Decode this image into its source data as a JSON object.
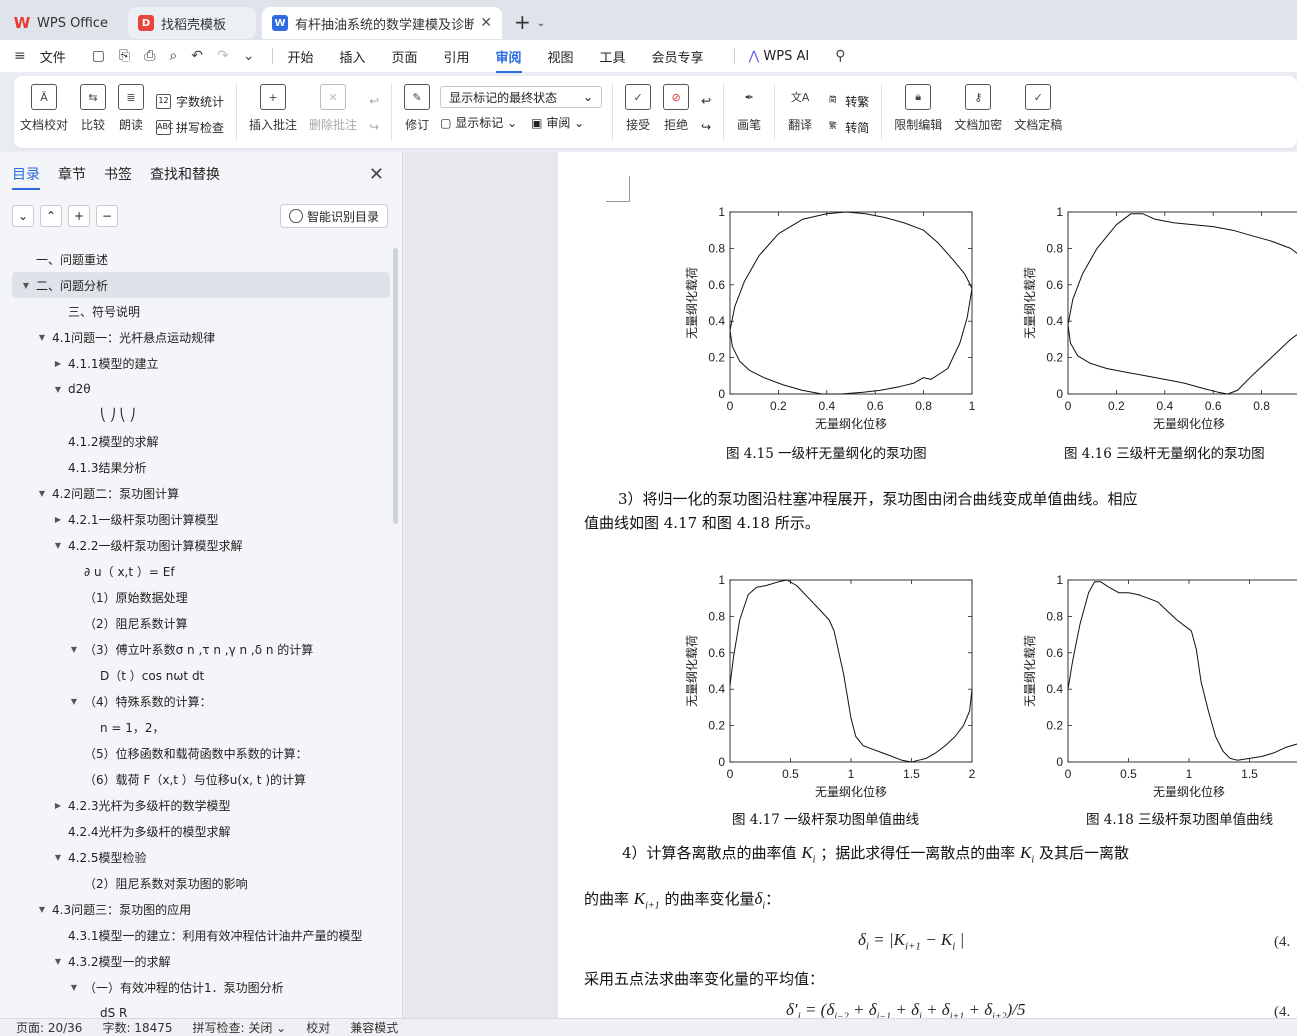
{
  "tabs": {
    "home": "WPS Office",
    "template": "找稻壳模板",
    "document": "有杆抽油系统的数学建模及诊断"
  },
  "menu": {
    "file": "文件",
    "items": [
      "开始",
      "插入",
      "页面",
      "引用",
      "审阅",
      "视图",
      "工具",
      "会员专享"
    ],
    "ai": "WPS AI"
  },
  "ribbon": {
    "proofread": "文档校对",
    "compare": "比较",
    "read_aloud": "朗读",
    "word_count": "字数统计",
    "spell_check": "拼写检查",
    "insert_comment": "插入批注",
    "delete_comment": "删除批注",
    "revise": "修订",
    "markup_select": "显示标记的最终状态",
    "show_markup": "显示标记",
    "review_pane": "审阅",
    "accept": "接受",
    "reject": "拒绝",
    "pen": "画笔",
    "translate": "翻译",
    "to_traditional": "转繁",
    "to_simplified": "转简",
    "restrict_edit": "限制编辑",
    "encrypt": "文档加密",
    "finalize": "文档定稿"
  },
  "sidebar": {
    "tabs": [
      "目录",
      "章节",
      "书签",
      "查找和替换"
    ],
    "smart_toc": "智能识别目录",
    "toc": [
      {
        "label": "一、问题重述",
        "indent": 0,
        "arrow": ""
      },
      {
        "label": "二、问题分析",
        "indent": 0,
        "arrow": "down",
        "selected": true
      },
      {
        "label": "三、符号说明",
        "indent": 2,
        "arrow": ""
      },
      {
        "label": "4.1问题一：光杆悬点运动规律",
        "indent": 1,
        "arrow": "down"
      },
      {
        "label": "4.1.1模型的建立",
        "indent": 2,
        "arrow": "right"
      },
      {
        "label": "d2θ",
        "indent": 2,
        "arrow": "down"
      },
      {
        "label": "⎝ ⎠ ⎝ ⎠",
        "indent": 4,
        "arrow": ""
      },
      {
        "label": "4.1.2模型的求解",
        "indent": 2,
        "arrow": ""
      },
      {
        "label": "4.1.3结果分析",
        "indent": 2,
        "arrow": ""
      },
      {
        "label": "4.2问题二：泵功图计算",
        "indent": 1,
        "arrow": "down"
      },
      {
        "label": "4.2.1一级杆泵功图计算模型",
        "indent": 2,
        "arrow": "right"
      },
      {
        "label": "4.2.2一级杆泵功图计算模型求解",
        "indent": 2,
        "arrow": "down"
      },
      {
        "label": "∂ u（ x,t ）= Ef",
        "indent": 3,
        "arrow": ""
      },
      {
        "label": "（1）原始数据处理",
        "indent": 3,
        "arrow": ""
      },
      {
        "label": "（2）阻尼系数计算",
        "indent": 3,
        "arrow": ""
      },
      {
        "label": "（3）傅立叶系数σ n ,τ n ,γ n ,δ n 的计算",
        "indent": 3,
        "arrow": "down"
      },
      {
        "label": "D（t ）cos nωt dt",
        "indent": 4,
        "arrow": ""
      },
      {
        "label": "（4）特殊系数的计算：",
        "indent": 3,
        "arrow": "down"
      },
      {
        "label": "n = 1，2，",
        "indent": 4,
        "arrow": ""
      },
      {
        "label": "（5）位移函数和载荷函数中系数的计算：",
        "indent": 3,
        "arrow": ""
      },
      {
        "label": "（6）载荷 F（x,t ）与位移u(x, t )的计算",
        "indent": 3,
        "arrow": ""
      },
      {
        "label": "4.2.3光杆为多级杆的数学模型",
        "indent": 2,
        "arrow": "right"
      },
      {
        "label": "4.2.4光杆为多级杆的模型求解",
        "indent": 2,
        "arrow": ""
      },
      {
        "label": "4.2.5模型检验",
        "indent": 2,
        "arrow": "down"
      },
      {
        "label": "（2）阻尼系数对泵功图的影响",
        "indent": 3,
        "arrow": ""
      },
      {
        "label": "4.3问题三：泵功图的应用",
        "indent": 1,
        "arrow": "down"
      },
      {
        "label": "4.3.1模型一的建立：利用有效冲程估计油井产量的模型",
        "indent": 2,
        "arrow": ""
      },
      {
        "label": "4.3.2模型一的求解",
        "indent": 2,
        "arrow": "down"
      },
      {
        "label": "（一）有效冲程的估计1．泵功图分析",
        "indent": 3,
        "arrow": "down"
      },
      {
        "label": "dS R",
        "indent": 4,
        "arrow": ""
      }
    ]
  },
  "document": {
    "fig15_caption": "图 4.15  一级杆无量纲化的泵功图",
    "fig16_caption": "图 4.16  三级杆无量纲化的泵功图",
    "fig17_caption": "图 4.17  一级杆泵功图单值曲线",
    "fig18_caption": "图 4.18  三级杆泵功图单值曲线",
    "para3_line1": "3）将归一化的泵功图沿柱塞冲程展开，泵功图由闭合曲线变成单值曲线。相应",
    "para3_line2": "值曲线如图  4.17 和图  4.18 所示。",
    "para4_a": "4）计算各离散点的曲率值",
    "para4_b": "；据此求得任一离散点的曲率",
    "para4_c": "及其后一离散",
    "para4_line2_a": "的曲率",
    "para4_line2_b": "的曲率变化量",
    "para5": "采用五点法求曲率变化量的平均值：",
    "eq_num1": "(4.",
    "eq_num2": "(4."
  },
  "chart_data": [
    {
      "type": "line",
      "title": "",
      "xlabel": "无量纲化位移",
      "ylabel": "无量纲化载荷",
      "xlim": [
        0,
        1
      ],
      "ylim": [
        0,
        1
      ],
      "xticks": [
        "0",
        "0.2",
        "0.4",
        "0.6",
        "0.8",
        "1"
      ],
      "yticks": [
        "0",
        "0.2",
        "0.4",
        "0.6",
        "0.8",
        "1"
      ],
      "series": [
        {
          "x": [
            0.0,
            0.02,
            0.06,
            0.12,
            0.2,
            0.3,
            0.4,
            0.48,
            0.56,
            0.64,
            0.72,
            0.8,
            0.86,
            0.92,
            0.97,
            1.0,
            0.98,
            0.95,
            0.9,
            0.83,
            0.8,
            0.76,
            0.7,
            0.62,
            0.55,
            0.46,
            0.38,
            0.3,
            0.22,
            0.14,
            0.08,
            0.04,
            0.01,
            0.0
          ],
          "y": [
            0.35,
            0.48,
            0.62,
            0.76,
            0.88,
            0.96,
            0.99,
            1.0,
            0.99,
            0.97,
            0.94,
            0.9,
            0.83,
            0.74,
            0.66,
            0.58,
            0.42,
            0.28,
            0.14,
            0.08,
            0.09,
            0.06,
            0.04,
            0.02,
            0.01,
            0.0,
            0.0,
            0.02,
            0.05,
            0.09,
            0.13,
            0.18,
            0.26,
            0.35
          ]
        }
      ]
    },
    {
      "type": "line",
      "title": "",
      "xlabel": "无量纲化位移",
      "ylabel": "无量纲化载荷",
      "xlim": [
        0,
        1
      ],
      "ylim": [
        0,
        1
      ],
      "xticks": [
        "0",
        "0.2",
        "0.4",
        "0.6",
        "0.8"
      ],
      "yticks": [
        "0",
        "0.2",
        "0.4",
        "0.6",
        "0.8",
        "1"
      ],
      "series": [
        {
          "x": [
            0.0,
            0.02,
            0.06,
            0.12,
            0.2,
            0.26,
            0.31,
            0.36,
            0.44,
            0.52,
            0.6,
            0.68,
            0.76,
            0.84,
            0.92,
            1.0,
            1.0,
            0.92,
            0.84,
            0.76,
            0.7,
            0.66,
            0.62,
            0.56,
            0.48,
            0.4,
            0.32,
            0.24,
            0.16,
            0.09,
            0.04,
            0.01,
            0.0
          ],
          "y": [
            0.38,
            0.52,
            0.66,
            0.8,
            0.93,
            0.99,
            0.99,
            0.96,
            0.94,
            0.93,
            0.92,
            0.9,
            0.87,
            0.84,
            0.8,
            0.72,
            0.38,
            0.3,
            0.2,
            0.1,
            0.02,
            0.0,
            0.01,
            0.03,
            0.06,
            0.08,
            0.1,
            0.12,
            0.14,
            0.17,
            0.21,
            0.28,
            0.38
          ]
        }
      ]
    },
    {
      "type": "line",
      "title": "",
      "xlabel": "无量纲化位移",
      "ylabel": "无量纲化载荷",
      "xlim": [
        0,
        2
      ],
      "ylim": [
        0,
        1
      ],
      "xticks": [
        "0",
        "0.5",
        "1",
        "1.5",
        "2"
      ],
      "yticks": [
        "0",
        "0.2",
        "0.4",
        "0.6",
        "0.8",
        "1"
      ],
      "series": [
        {
          "x": [
            0.0,
            0.03,
            0.08,
            0.15,
            0.22,
            0.3,
            0.4,
            0.47,
            0.55,
            0.65,
            0.75,
            0.82,
            0.86,
            0.9,
            0.94,
            0.97,
            1.0,
            1.04,
            1.1,
            1.18,
            1.26,
            1.34,
            1.42,
            1.5,
            1.56,
            1.62,
            1.7,
            1.78,
            1.86,
            1.93,
            1.98,
            2.0
          ],
          "y": [
            0.42,
            0.58,
            0.78,
            0.92,
            0.96,
            0.97,
            0.99,
            1.0,
            0.97,
            0.9,
            0.83,
            0.78,
            0.72,
            0.6,
            0.48,
            0.36,
            0.24,
            0.14,
            0.09,
            0.07,
            0.05,
            0.03,
            0.01,
            0.0,
            0.01,
            0.02,
            0.05,
            0.09,
            0.14,
            0.2,
            0.28,
            0.4
          ]
        }
      ]
    },
    {
      "type": "line",
      "title": "",
      "xlabel": "无量纲化位移",
      "ylabel": "无量纲化载荷",
      "xlim": [
        0,
        2
      ],
      "ylim": [
        0,
        1
      ],
      "xticks": [
        "0",
        "0.5",
        "1",
        "1.5"
      ],
      "yticks": [
        "0",
        "0.2",
        "0.4",
        "0.6",
        "0.8",
        "1"
      ],
      "series": [
        {
          "x": [
            0.0,
            0.04,
            0.1,
            0.17,
            0.22,
            0.27,
            0.34,
            0.42,
            0.5,
            0.58,
            0.66,
            0.74,
            0.82,
            0.9,
            0.98,
            1.02,
            1.06,
            1.1,
            1.16,
            1.22,
            1.28,
            1.34,
            1.4,
            1.5,
            1.6,
            1.7,
            1.8,
            1.9,
            2.0
          ],
          "y": [
            0.4,
            0.56,
            0.76,
            0.93,
            0.99,
            0.99,
            0.96,
            0.93,
            0.93,
            0.92,
            0.9,
            0.88,
            0.83,
            0.78,
            0.74,
            0.72,
            0.62,
            0.44,
            0.28,
            0.14,
            0.06,
            0.02,
            0.01,
            0.02,
            0.03,
            0.05,
            0.08,
            0.1,
            0.12
          ]
        }
      ]
    }
  ],
  "status": {
    "page": "页面: 20/36",
    "words": "字数: 18475",
    "spell": "拼写检查: 关闭",
    "proof": "校对",
    "compat": "兼容模式"
  }
}
